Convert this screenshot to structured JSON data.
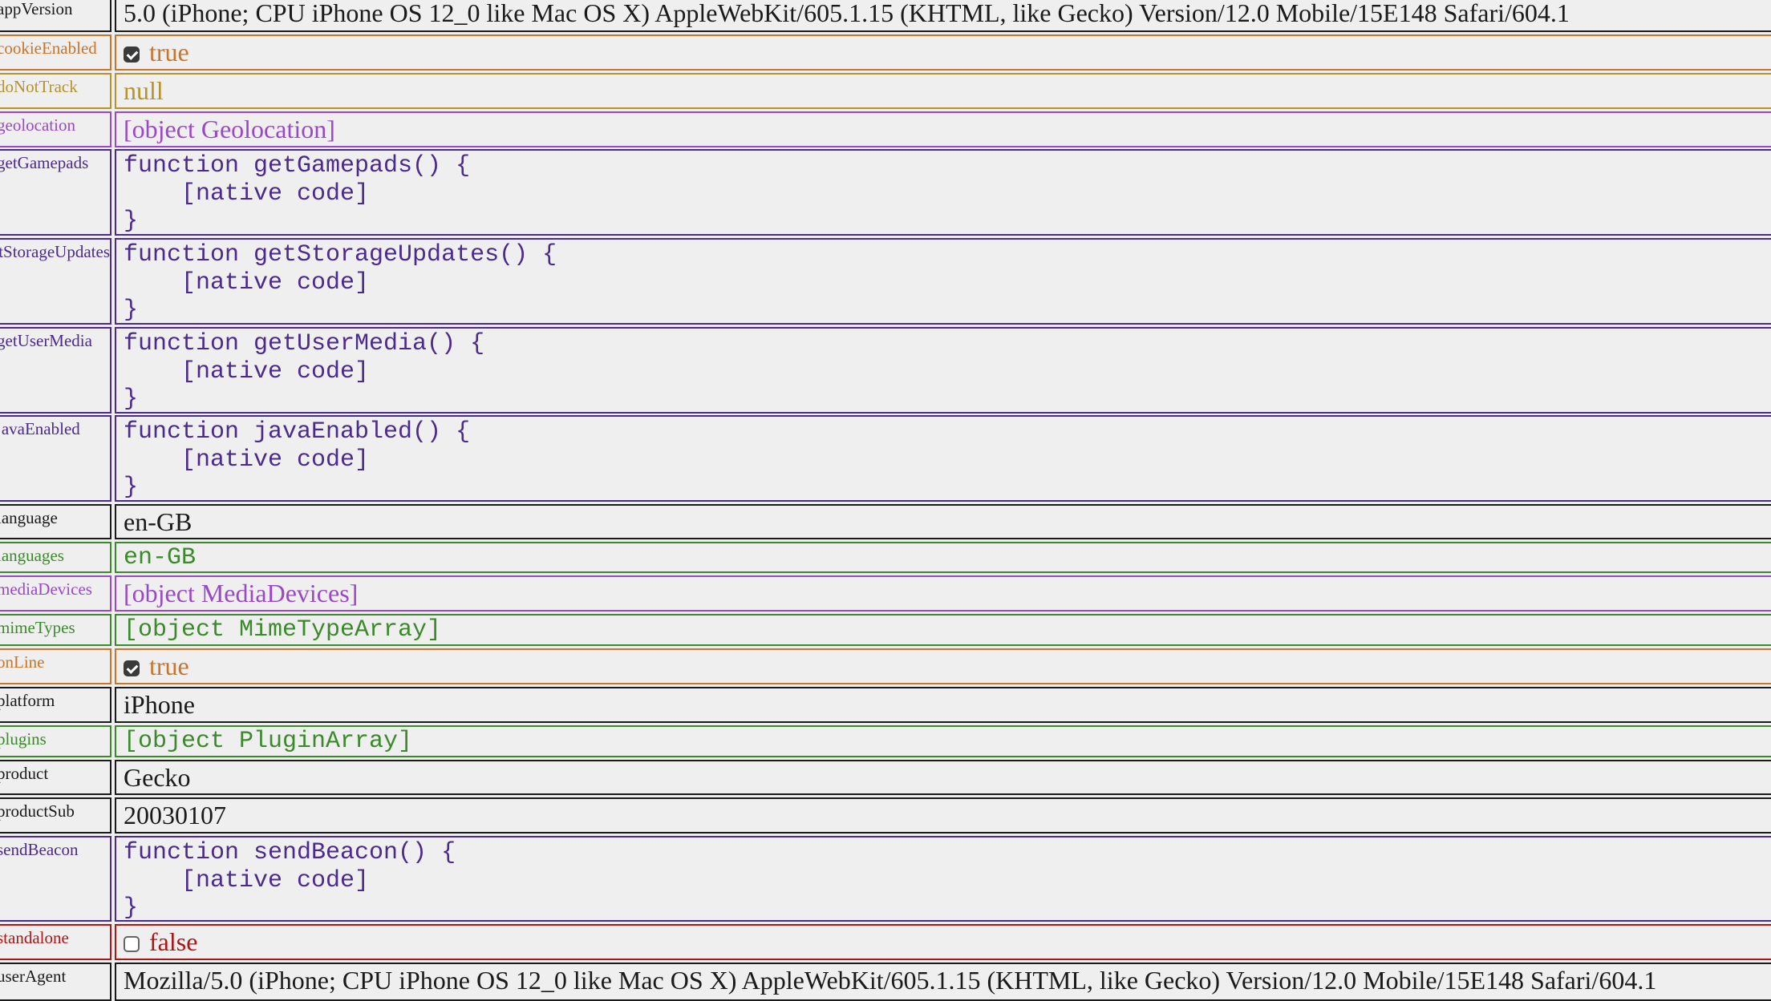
{
  "rows": [
    {
      "key": "appVersion",
      "value": "5.0 (iPhone; CPU iPhone OS 12_0 like Mac OS X) AppleWebKit/605.1.15 (KHTML, like Gecko) Version/12.0 Mobile/15E148 Safari/604.1",
      "kind": "serif",
      "color": "#1a1a1a"
    },
    {
      "key": "cookieEnabled",
      "value": "true",
      "kind": "bool",
      "checked": true,
      "color": "#c8742a"
    },
    {
      "key": "doNotTrack",
      "value": "null",
      "kind": "serif",
      "color": "#b59328"
    },
    {
      "key": "geolocation",
      "value": "[object Geolocation]",
      "kind": "serif",
      "color": "#9a48c8"
    },
    {
      "key": "getGamepads",
      "value": "function getGamepads() {\n    [native code]\n}",
      "kind": "pre",
      "color": "#4a2a8c"
    },
    {
      "key": "getStorageUpdates",
      "value": "function getStorageUpdates() {\n    [native code]\n}",
      "kind": "pre",
      "color": "#4a2a8c"
    },
    {
      "key": "getUserMedia",
      "value": "function getUserMedia() {\n    [native code]\n}",
      "kind": "pre",
      "color": "#4a2a8c"
    },
    {
      "key": "javaEnabled",
      "value": "function javaEnabled() {\n    [native code]\n}",
      "kind": "pre",
      "color": "#4a2a8c"
    },
    {
      "key": "language",
      "value": "en-GB",
      "kind": "serif",
      "color": "#1a1a1a"
    },
    {
      "key": "languages",
      "value": "en-GB",
      "kind": "mono",
      "color": "#3a8a2a"
    },
    {
      "key": "mediaDevices",
      "value": "[object MediaDevices]",
      "kind": "serif",
      "color": "#9a48c8"
    },
    {
      "key": "mimeTypes",
      "value": "[object MimeTypeArray]",
      "kind": "mono",
      "color": "#3a8a2a"
    },
    {
      "key": "onLine",
      "value": "true",
      "kind": "bool",
      "checked": true,
      "color": "#c8742a"
    },
    {
      "key": "platform",
      "value": "iPhone",
      "kind": "serif",
      "color": "#1a1a1a"
    },
    {
      "key": "plugins",
      "value": "[object PluginArray]",
      "kind": "mono",
      "color": "#3a8a2a"
    },
    {
      "key": "product",
      "value": "Gecko",
      "kind": "serif",
      "color": "#1a1a1a"
    },
    {
      "key": "productSub",
      "value": "20030107",
      "kind": "serif",
      "color": "#1a1a1a"
    },
    {
      "key": "sendBeacon",
      "value": "function sendBeacon() {\n    [native code]\n}",
      "kind": "pre",
      "color": "#4a2a8c"
    },
    {
      "key": "standalone",
      "value": "false",
      "kind": "bool",
      "checked": false,
      "color": "#a81818"
    },
    {
      "key": "userAgent",
      "value": "Mozilla/5.0 (iPhone; CPU iPhone OS 12_0 like Mac OS X) AppleWebKit/605.1.15 (KHTML, like Gecko) Version/12.0 Mobile/15E148 Safari/604.1",
      "kind": "serif",
      "color": "#1a1a1a"
    }
  ]
}
